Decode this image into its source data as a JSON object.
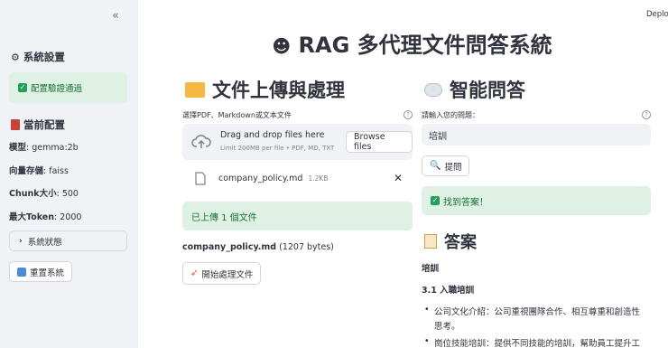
{
  "sidebar": {
    "collapse_icon": "«",
    "settings_title": "系統設置",
    "config_status": "配置驗證通過",
    "current_title": "當前配置",
    "config": [
      {
        "label": "模型",
        "value": ": gemma:2b"
      },
      {
        "label": "向量存儲",
        "value": ": faiss"
      },
      {
        "label": "Chunk大小",
        "value": ": 500"
      },
      {
        "label": "最大Token",
        "value": ": 2000"
      }
    ],
    "status_expander": "系統狀態",
    "reset_button": "重置系統"
  },
  "header": {
    "deploy": "Deploy",
    "title": "RAG 多代理文件問答系統"
  },
  "left": {
    "heading": "文件上傳與處理",
    "uploader_label": "選擇PDF、Markdown或文本文件",
    "drop_text": "Drag and drop files here",
    "drop_limit": "Limit 200MB per file • PDF, MD, TXT",
    "browse": "Browse files",
    "file_name": "company_policy.md",
    "file_size": "1.2KB",
    "upload_success": "已上傳 1 個文件",
    "file_info_name": "company_policy.md",
    "file_info_size": "(1207 bytes)",
    "process_button": "開始處理文件"
  },
  "right": {
    "heading": "智能問答",
    "question_label": "請輸入您的問題：",
    "question_value": "培訓",
    "ask_button": "提問",
    "found": "找到答案！",
    "answer_heading": "答案",
    "answer_title": "培訓",
    "answer_sub": "3.1 入職培訓",
    "bullets": [
      "公司文化介紹：公司重視團隊合作、相互尊重和創造性",
      "思考。",
      "崗位技能培訓：提供不同技能的培訓，幫助員工提升工"
    ]
  },
  "colors": {
    "sidebar_bg": "#f0f2f6",
    "success_bg": "#dff0e4",
    "success_text": "#177233"
  }
}
